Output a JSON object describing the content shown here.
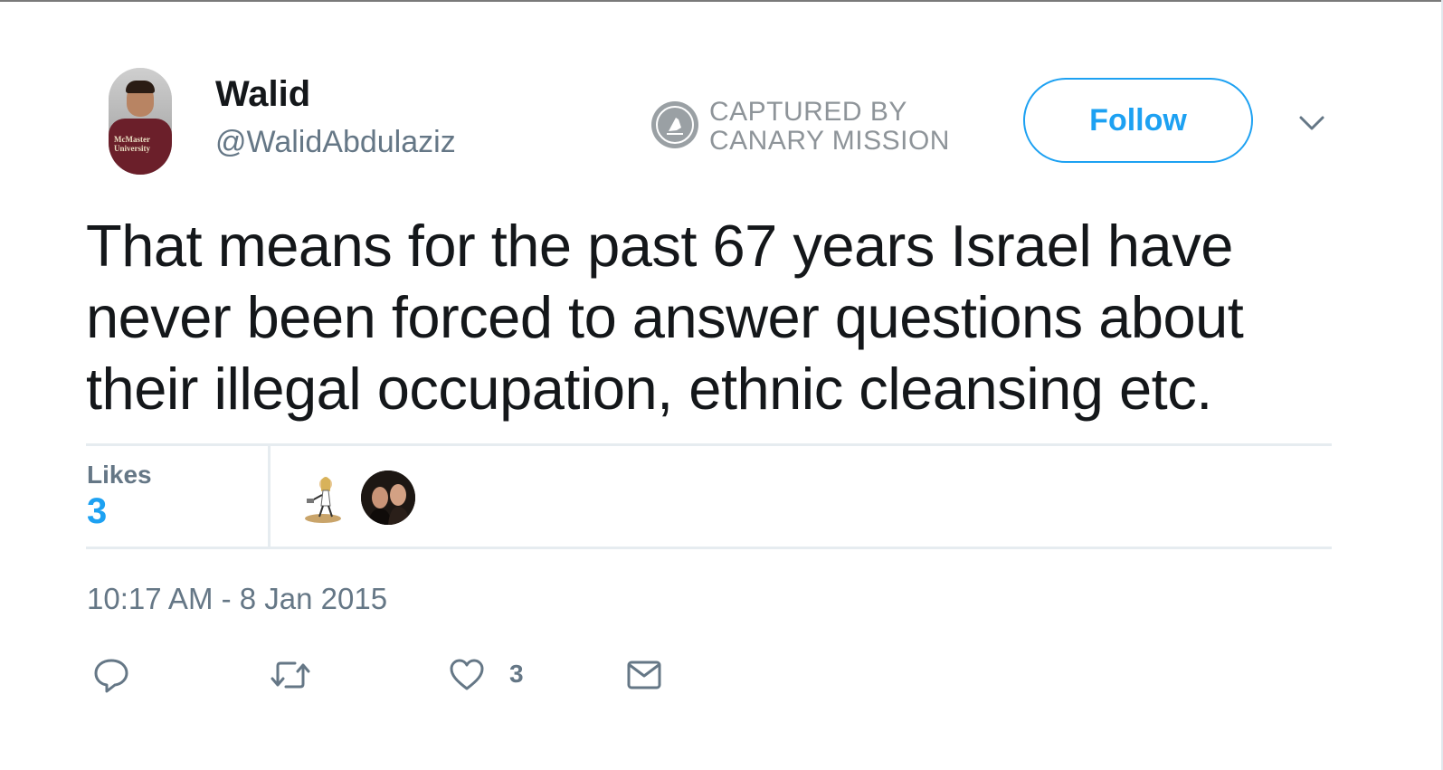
{
  "user": {
    "display_name": "Walid",
    "handle": "@WalidAbdulaziz",
    "avatar_text": "McMaster University"
  },
  "watermark": {
    "line1": "CAPTURED BY",
    "line2": "CANARY MISSION"
  },
  "follow_label": "Follow",
  "tweet": {
    "text": "That means for the past 67 years Israel have never been forced to answer questions about their illegal occupation, ethnic cleansing etc."
  },
  "stats": {
    "likes_label": "Likes",
    "likes_count": "3"
  },
  "timestamp": "10:17 AM - 8 Jan 2015",
  "actions": {
    "reply_icon": "reply-icon",
    "retweet_icon": "retweet-icon",
    "like_icon": "heart-icon",
    "like_count": "3",
    "dm_icon": "envelope-icon"
  },
  "colors": {
    "accent": "#1da1f2",
    "secondary_text": "#657786",
    "divider": "#e6ecf0",
    "text": "#14171a"
  }
}
